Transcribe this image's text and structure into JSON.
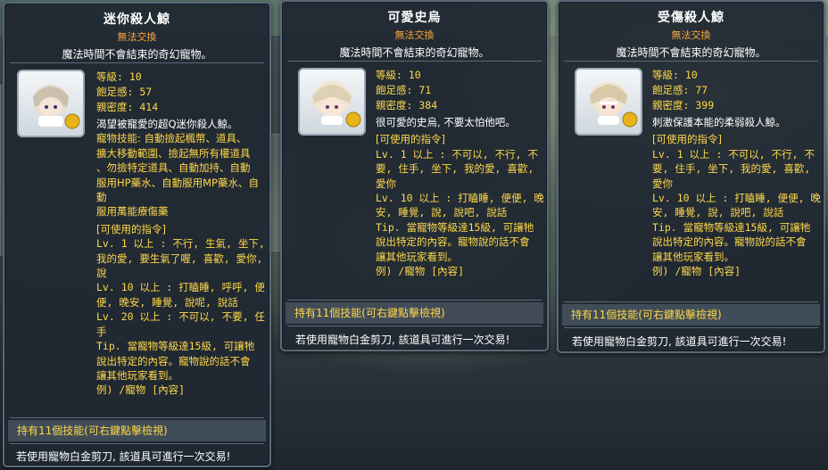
{
  "tooltips": [
    {
      "title": "迷你殺人鯨",
      "tradeable": "無法交換",
      "description": "魔法時間不會結束的奇幻寵物。",
      "stats": {
        "level": "等級: 10",
        "fullness": "飽足感: 57",
        "closeness": "親密度: 414"
      },
      "flavor": "渴望被寵愛的超Q迷你殺人鯨。",
      "skills_lines": [
        "寵物技能: 自動撿起楓幣、道具、",
        "擴大移動範圍、撿起無所有權道具",
        "、勿撿特定道具、自動加持、自動",
        "服用HP藥水、自動服用MP藥水、自動",
        "服用萬能療傷藥"
      ],
      "commands_header": "[可使用的指令]",
      "command_lines": [
        "Lv. 1 以上 : 不行, 生氣, 坐下,",
        "我的愛, 要生氣了喔, 喜歡, 愛你,",
        "說",
        "Lv. 10 以上 : 打瞌睡, 呼呼, 便",
        "便, 晚安, 睡覺, 說呢, 說話",
        "Lv. 20 以上 : 不可以, 不要, 任",
        "手",
        "Tip. 當寵物等級達15級, 可讓牠",
        "說出特定的內容。寵物說的話不會",
        "讓其他玩家看到。",
        "例) /寵物 [內容]"
      ],
      "skills_bar": "持有11個技能(可右鍵點擊檢視)",
      "trade_note": "若使用寵物白金剪刀, 該道具可進行一次交易!"
    },
    {
      "title": "可愛史烏",
      "tradeable": "無法交換",
      "description": "魔法時間不會結束的奇幻寵物。",
      "stats": {
        "level": "等級: 10",
        "fullness": "飽足感: 71",
        "closeness": "親密度: 384"
      },
      "flavor": "很可愛的史烏, 不要太怕他吧。",
      "commands_header": "[可使用的指令]",
      "command_lines": [
        "Lv. 1 以上 : 不可以, 不行, 不",
        "要, 住手, 坐下, 我的愛, 喜歡,",
        "愛你",
        "Lv. 10 以上 : 打瞌睡, 便便, 晚",
        "安, 睡覺, 說, 說吧, 說話",
        "Tip. 當寵物等級達15級, 可讓牠",
        "說出特定的內容。寵物說的話不會",
        "讓其他玩家看到。",
        "例) /寵物 [內容]"
      ],
      "skills_bar": "持有11個技能(可右鍵點擊檢視)",
      "trade_note": "若使用寵物白金剪刀, 該道具可進行一次交易!"
    },
    {
      "title": "受傷殺人鯨",
      "tradeable": "無法交換",
      "description": "魔法時間不會結束的奇幻寵物。",
      "stats": {
        "level": "等級: 10",
        "fullness": "飽足感: 77",
        "closeness": "親密度: 399"
      },
      "flavor": "刺激保護本能的柔弱殺人鯨。",
      "commands_header": "[可使用的指令]",
      "command_lines": [
        "Lv. 1 以上 : 不可以, 不行, 不",
        "要, 住手, 坐下, 我的愛, 喜歡,",
        "愛你",
        "Lv. 10 以上 : 打瞌睡, 便便, 晚",
        "安, 睡覺, 說, 說吧, 說話",
        "Tip. 當寵物等級達15級, 可讓牠",
        "說出特定的內容。寵物說的話不會",
        "讓其他玩家看到。",
        "例) /寵物 [內容]"
      ],
      "skills_bar": "持有11個技能(可右鍵點擊檢視)",
      "trade_note": "若使用寵物白金剪刀, 該道具可進行一次交易!"
    }
  ]
}
